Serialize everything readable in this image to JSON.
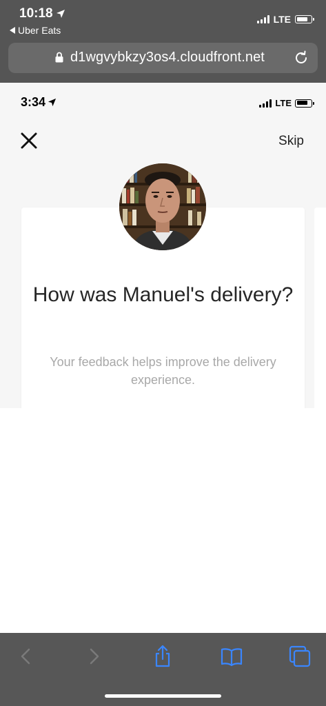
{
  "outer_status": {
    "time": "10:18",
    "back_app": "Uber Eats",
    "network": "LTE"
  },
  "url_bar": {
    "url": "d1wgvybkzy3os4.cloudfront.net"
  },
  "inner_status": {
    "time": "3:34",
    "network": "LTE"
  },
  "header": {
    "skip_label": "Skip"
  },
  "rating_card": {
    "question": "How was Manuel's delivery?",
    "subtext": "Your feedback helps improve the delivery experience."
  },
  "colors": {
    "safari_chrome": "#555555",
    "toolbar": "#575757",
    "toolbar_icon_active": "#3a86ff",
    "toolbar_icon_disabled": "#7a7a7a",
    "page_background": "#f6f6f6",
    "subtext": "#a8a8a8"
  },
  "icons": {
    "close": "close-icon",
    "lock": "lock-icon",
    "reload": "reload-icon",
    "back": "back-icon",
    "forward": "forward-icon",
    "share": "share-icon",
    "bookmarks": "bookmarks-icon",
    "tabs": "tabs-icon"
  }
}
